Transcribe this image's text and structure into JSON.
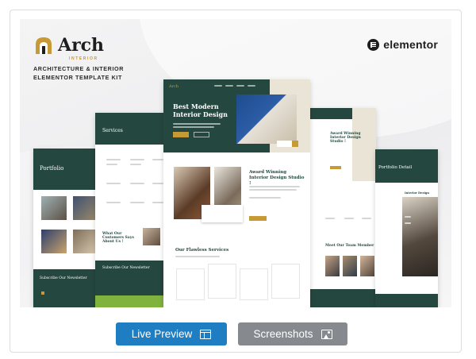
{
  "brand": {
    "name": "Arch",
    "subname": "INTERIOR",
    "tagline_line1": "ARCHITECTURE & INTERIOR",
    "tagline_line2": "ELEMENTOR TEMPLATE KIT"
  },
  "builder": {
    "name": "elementor"
  },
  "preview": {
    "home_hero_title": "Best Modern Interior Design",
    "home_award_title": "Award Winning Interior Design Studio !",
    "home_services_title": "Our Flawless Services",
    "home_logo": "Arch",
    "services_title": "Services",
    "services_testimonial": "What Our Customers Says About Us !",
    "services_newsletter": "Subscribe Our Newsletter",
    "portfolio_title": "Portfolio",
    "portfolio_newsletter": "Subscribe Our Newsletter",
    "about_title": "Award Winning Interior Design Studio !",
    "about_team": "Meet Our Team Member",
    "detail_title": "Portfolio Detail",
    "detail_heading": "Interior Design Projects"
  },
  "actions": {
    "live_preview": "Live Preview",
    "screenshots": "Screenshots"
  },
  "colors": {
    "primary_green": "#24473f",
    "gold": "#c89a35",
    "live_button": "#1f7ec1",
    "screens_button": "#868a8f"
  }
}
